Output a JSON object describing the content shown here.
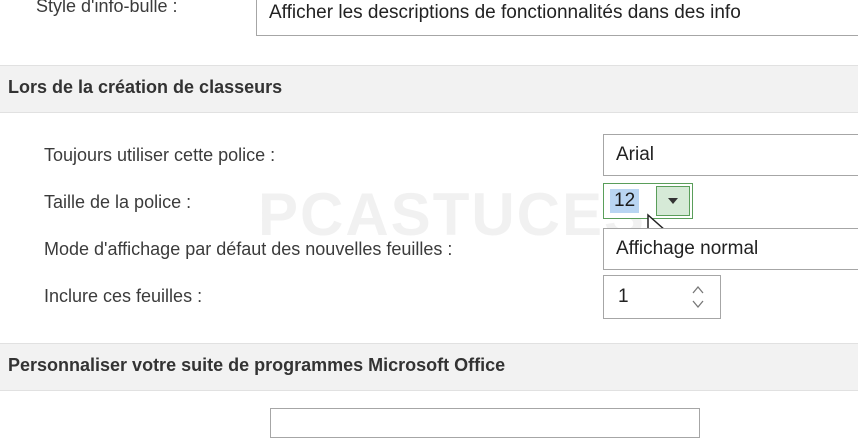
{
  "top": {
    "tooltip_label": "Style d'info-bulle :",
    "tooltip_value": "Afficher les descriptions de fonctionnalités dans des info"
  },
  "sections": {
    "workbook_title": "Lors de la création de classeurs",
    "office_title": "Personnaliser votre suite de programmes Microsoft Office"
  },
  "rows": {
    "font_label": "Toujours utiliser cette police :",
    "font_value": "Arial",
    "size_label": "Taille de la police :",
    "size_value": "12",
    "view_label": "Mode d'affichage par défaut des nouvelles feuilles :",
    "view_value": "Affichage normal",
    "sheets_label": "Inclure ces feuilles :",
    "sheets_value": "1"
  },
  "watermark": "PCASTUCES",
  "icons": {
    "dropdown": "chevron-down-icon",
    "spinner": "spinner-arrows-icon",
    "cursor": "mouse-pointer-icon"
  },
  "colors": {
    "section_bg": "#f2f2f2",
    "selection": "#b9d5f2",
    "focus_border": "#5a9e5a"
  }
}
